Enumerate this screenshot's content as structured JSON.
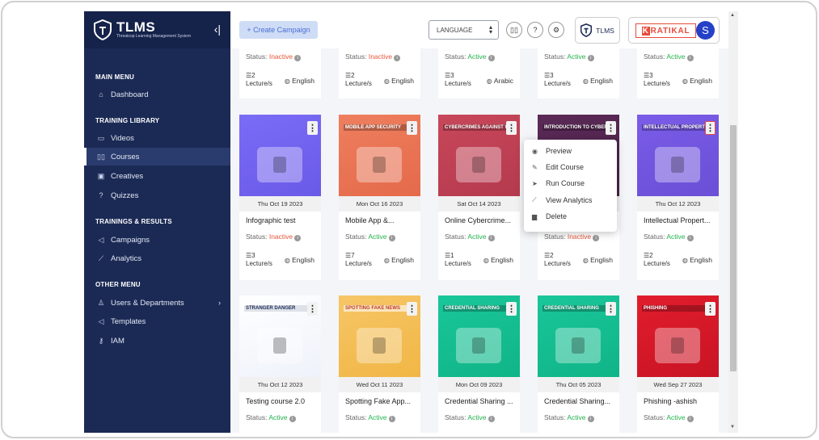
{
  "app": {
    "name": "TLMS",
    "tagline": "Threatcop Learning Management System"
  },
  "sidebar": {
    "sections": [
      "MAIN MENU",
      "TRAINING LIBRARY",
      "TRAININGS & RESULTS",
      "OTHER MENU"
    ],
    "items": [
      {
        "label": "Dashboard",
        "icon": "home-icon"
      },
      {
        "label": "Videos",
        "icon": "video-icon"
      },
      {
        "label": "Courses",
        "icon": "book-icon"
      },
      {
        "label": "Creatives",
        "icon": "image-icon"
      },
      {
        "label": "Quizzes",
        "icon": "question-icon"
      },
      {
        "label": "Campaigns",
        "icon": "megaphone-icon"
      },
      {
        "label": "Analytics",
        "icon": "chart-icon"
      },
      {
        "label": "Users & Departments",
        "icon": "user-icon"
      },
      {
        "label": "Templates",
        "icon": "megaphone-icon"
      },
      {
        "label": "IAM",
        "icon": "key-icon"
      }
    ]
  },
  "topbar": {
    "create_label": "+ Create Campaign",
    "language_label": "LANGUAGE",
    "product_label": "TLMS",
    "company_label": "KRATIKAL",
    "avatar_initial": "S"
  },
  "cards_top": [
    {
      "status": "Inactive",
      "lectures": "2",
      "language": "English"
    },
    {
      "status": "Inactive",
      "lectures": "2",
      "language": "English"
    },
    {
      "status": "Active",
      "lectures": "3",
      "language": "Arabic"
    },
    {
      "status": "Active",
      "lectures": "3",
      "language": "English"
    },
    {
      "status": "Active",
      "lectures": "3",
      "language": "English"
    }
  ],
  "cards_mid": [
    {
      "date": "Thu Oct 19 2023",
      "title": "Infographic test",
      "status": "Inactive",
      "lectures": "3",
      "language": "English",
      "thumb_label": ""
    },
    {
      "date": "Mon Oct 16 2023",
      "title": "Mobile App &...",
      "status": "Active",
      "lectures": "7",
      "language": "English",
      "thumb_label": "MOBILE APP SECURITY"
    },
    {
      "date": "Sat Oct 14 2023",
      "title": "Online Cybercrime...",
      "status": "Active",
      "lectures": "1",
      "language": "English",
      "thumb_label": "CYBERCRIMES AGAINST WOM"
    },
    {
      "date": "",
      "title": "",
      "status": "Inactive",
      "lectures": "2",
      "language": "English",
      "thumb_label": "INTRODUCTION TO CYBERCR"
    },
    {
      "date": "Thu Oct 12 2023",
      "title": "Intellectual Propert...",
      "status": "Active",
      "lectures": "2",
      "language": "English",
      "thumb_label": "INTELLECTUAL PROPERT"
    }
  ],
  "cards_bot": [
    {
      "date": "Thu Oct 12 2023",
      "title": "Testing course 2.0",
      "status": "Active",
      "thumb_label": "STRANGER DANGER"
    },
    {
      "date": "Wed Oct 11 2023",
      "title": "Spotting Fake App...",
      "status": "Active",
      "thumb_label": "SPOTTING FAKE NEWS"
    },
    {
      "date": "Mon Oct 09 2023",
      "title": "Credential Sharing ...",
      "status": "Active",
      "thumb_label": "CREDENTIAL SHARING"
    },
    {
      "date": "Thu Oct 05 2023",
      "title": "Credential Sharing...",
      "status": "Active",
      "thumb_label": "CREDENTIAL SHARING"
    },
    {
      "date": "Wed Sep 27 2023",
      "title": "Phishing -ashish",
      "status": "Active",
      "thumb_label": "PHISHING"
    }
  ],
  "labels": {
    "status_prefix": "Status:",
    "lecture_suffix": "Lecture/s"
  },
  "context_menu": [
    {
      "label": "Preview",
      "icon": "eye-icon"
    },
    {
      "label": "Edit Course",
      "icon": "edit-icon"
    },
    {
      "label": "Run Course",
      "icon": "send-icon"
    },
    {
      "label": "View Analytics",
      "icon": "analytics-icon"
    },
    {
      "label": "Delete",
      "icon": "trash-icon"
    }
  ],
  "colors": {
    "sidebar": "#1b2a55",
    "active": "#22b14c",
    "inactive": "#e8573a",
    "accent": "#4a6fd6"
  }
}
